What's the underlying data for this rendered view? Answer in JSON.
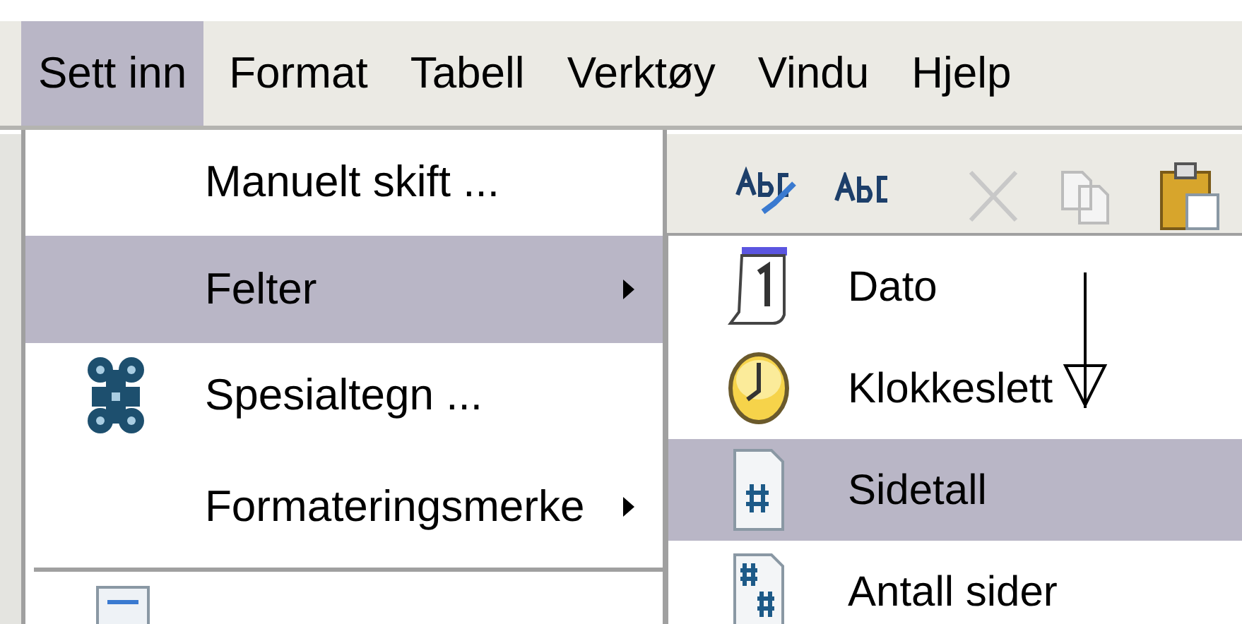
{
  "menubar": [
    {
      "label": "Sett inn",
      "selected": true
    },
    {
      "label": "Format",
      "selected": false
    },
    {
      "label": "Tabell",
      "selected": false
    },
    {
      "label": "Verktøy",
      "selected": false
    },
    {
      "label": "Vindu",
      "selected": false
    },
    {
      "label": "Hjelp",
      "selected": false
    }
  ],
  "menu": {
    "items": [
      {
        "kind": "item",
        "label": "Manuelt skift ...",
        "has_submenu": false,
        "selected": false
      },
      {
        "kind": "item",
        "label": "Felter",
        "has_submenu": true,
        "selected": true
      },
      {
        "kind": "item",
        "label": "Spesialtegn ...",
        "has_submenu": false,
        "selected": false
      },
      {
        "kind": "item",
        "label": "Formateringsmerke",
        "has_submenu": true,
        "selected": false
      },
      {
        "kind": "separator"
      }
    ]
  },
  "submenu": {
    "items": [
      {
        "label": "Dato",
        "selected": false
      },
      {
        "label": "Klokkeslett",
        "selected": false
      },
      {
        "label": "Sidetall",
        "selected": true
      },
      {
        "label": "Antall sider",
        "selected": false
      }
    ]
  }
}
